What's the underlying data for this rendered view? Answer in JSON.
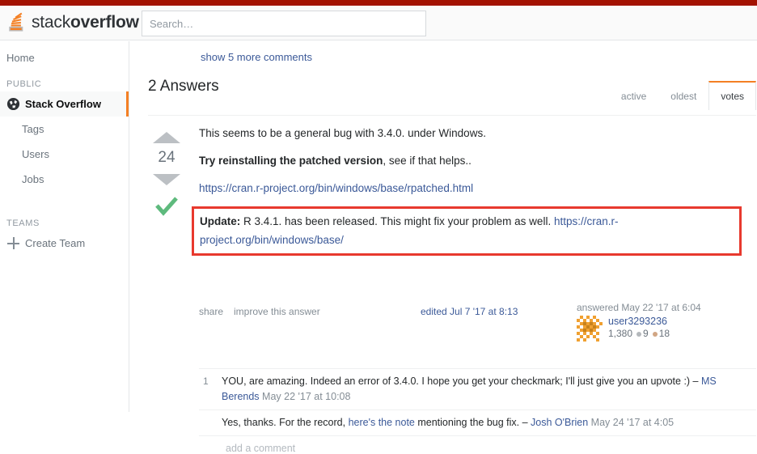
{
  "header": {
    "logo_text_light": "stack",
    "logo_text_bold": "overflow",
    "search_placeholder": "Search…",
    "search_value": ""
  },
  "sidebar": {
    "home_label": "Home",
    "public_heading": "PUBLIC",
    "public_items": [
      {
        "label": "Stack Overflow",
        "icon": "globe-icon",
        "active": true
      },
      {
        "label": "Tags",
        "active": false
      },
      {
        "label": "Users",
        "active": false
      },
      {
        "label": "Jobs",
        "active": false
      }
    ],
    "teams_heading": "TEAMS",
    "create_team_label": "Create Team"
  },
  "main": {
    "show_more_comments": "show 5 more comments",
    "answers_count_label": "2 Answers",
    "sort_tabs": [
      {
        "label": "active",
        "selected": false
      },
      {
        "label": "oldest",
        "selected": false
      },
      {
        "label": "votes",
        "selected": true
      }
    ]
  },
  "answer": {
    "vote_count": "24",
    "accepted": true,
    "paragraph_1": "This seems to be a general bug with 3.4.0. under Windows.",
    "paragraph_2_bold": "Try reinstalling the patched version",
    "paragraph_2_rest": ", see if that helps..",
    "link_rpatched": "https://cran.r-project.org/bin/windows/base/rpatched.html",
    "update_label": "Update:",
    "update_text": " R 3.4.1. has been released. This might fix your problem as well. ",
    "update_link": "https://cran.r-project.org/bin/windows/base/",
    "highlight_color": "#e8392e",
    "share_label": "share",
    "improve_label": "improve this answer",
    "edited_label": "edited Jul 7 '17 at 8:13",
    "answered_label": "answered May 22 '17 at 6:04",
    "username": "user3293236",
    "reputation": "1,380",
    "silver_badges": "9",
    "bronze_badges": "18"
  },
  "comments": [
    {
      "score": "1",
      "text": "YOU, are amazing. Indeed an error of 3.4.0. I hope you get your checkmark; I'll just give you an upvote :) – ",
      "user": "MS Berends",
      "date": " May 22 '17 at 10:08"
    },
    {
      "score": "",
      "text_before": "Yes, thanks. For the record, ",
      "link": "here's the note",
      "text_after": " mentioning the bug fix. – ",
      "user": "Josh O'Brien",
      "date": " May 24 '17 at 4:05"
    }
  ],
  "add_comment_label": "add a comment"
}
